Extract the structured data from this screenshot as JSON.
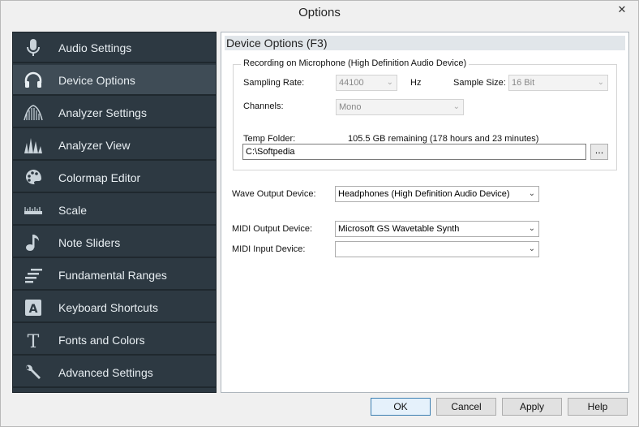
{
  "window": {
    "title": "Options"
  },
  "sidebar": {
    "items": [
      {
        "label": "Audio Settings",
        "icon": "microphone-icon"
      },
      {
        "label": "Device Options",
        "icon": "headphones-icon",
        "active": true
      },
      {
        "label": "Analyzer Settings",
        "icon": "analyzer-settings-icon"
      },
      {
        "label": "Analyzer View",
        "icon": "analyzer-view-icon"
      },
      {
        "label": "Colormap Editor",
        "icon": "palette-icon"
      },
      {
        "label": "Scale",
        "icon": "ruler-icon"
      },
      {
        "label": "Note Sliders",
        "icon": "music-note-icon"
      },
      {
        "label": "Fundamental Ranges",
        "icon": "ranges-icon"
      },
      {
        "label": "Keyboard Shortcuts",
        "icon": "keyboard-key-icon"
      },
      {
        "label": "Fonts and Colors",
        "icon": "font-icon"
      },
      {
        "label": "Advanced Settings",
        "icon": "wrench-icon"
      }
    ]
  },
  "panel": {
    "title": "Device Options (F3)",
    "recording": {
      "legend": "Recording on Microphone (High Definition Audio Device)",
      "sampling_rate_label": "Sampling Rate:",
      "sampling_rate_value": "44100",
      "hz_label": "Hz",
      "sample_size_label": "Sample Size:",
      "sample_size_value": "16 Bit",
      "channels_label": "Channels:",
      "channels_value": "Mono",
      "temp_folder_label": "Temp Folder:",
      "temp_folder_info": "105.5 GB remaining (178 hours and 23 minutes)",
      "temp_folder_value": "C:\\Softpedia",
      "browse_label": "..."
    },
    "wave_output_label": "Wave Output Device:",
    "wave_output_value": "Headphones (High Definition Audio Device)",
    "midi_output_label": "MIDI Output Device:",
    "midi_output_value": "Microsoft GS Wavetable Synth",
    "midi_input_label": "MIDI Input Device:",
    "midi_input_value": ""
  },
  "footer": {
    "ok": "OK",
    "cancel": "Cancel",
    "apply": "Apply",
    "help": "Help"
  },
  "colors": {
    "sidebar_bg": "#2d3942",
    "sidebar_active": "#3f4c56",
    "icon_color": "#c9d3da"
  }
}
